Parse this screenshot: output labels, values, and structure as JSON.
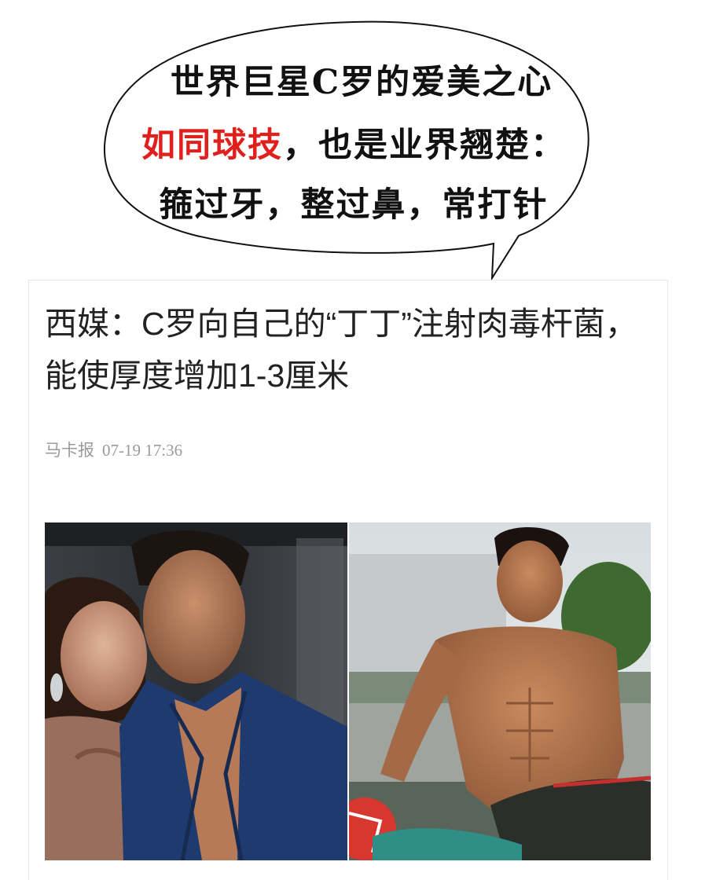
{
  "bubble": {
    "line1": "世界巨星C罗的爱美之心",
    "line2_highlight": "如同球技",
    "line2_rest": "，也是业界翘楚：",
    "line3": "箍过牙，整过鼻，常打针",
    "highlight_color": "#e0201c"
  },
  "article": {
    "title": "西媒：C罗向自己的“丁丁”注射肉毒杆菌，能使厚度增加1-3厘米",
    "source": "马卡报",
    "date": "07-19 17:36"
  },
  "photos": [
    {
      "name": "couple-selfie-photo"
    },
    {
      "name": "shirtless-player-photo"
    }
  ]
}
